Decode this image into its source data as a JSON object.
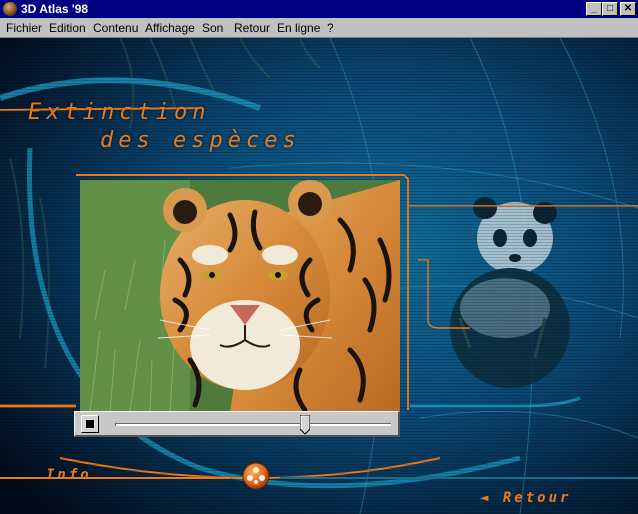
{
  "window": {
    "title": "3D Atlas '98",
    "controls": {
      "minimize": "_",
      "maximize": "□",
      "close": "✕"
    }
  },
  "menu": {
    "items": [
      {
        "label": "Fichier"
      },
      {
        "label": "Edition"
      },
      {
        "label": "Contenu"
      },
      {
        "label": "Affichage"
      },
      {
        "label": "Son"
      },
      {
        "label": "Retour"
      },
      {
        "label": "En ligne"
      },
      {
        "label": "?"
      }
    ]
  },
  "page": {
    "heading_line1": "Extinction",
    "heading_line2": "des espèces"
  },
  "video": {
    "subject": "tiger",
    "progress": 0.69
  },
  "footer": {
    "info_label": "Info",
    "back_label": "◄ Retour",
    "globe_icon": "globe-icon"
  },
  "colors": {
    "accent": "#e97a1e",
    "background": "#062a4a",
    "titlebar": "#000080"
  }
}
